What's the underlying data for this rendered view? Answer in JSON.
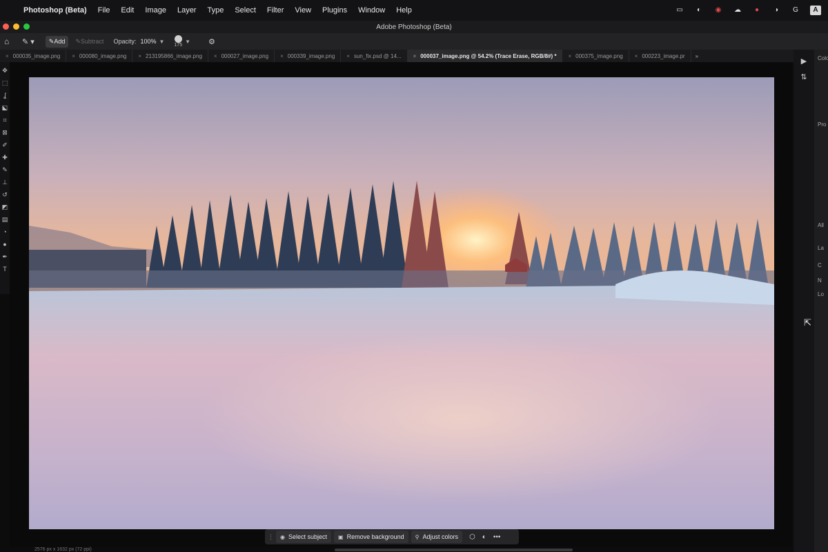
{
  "menubar": {
    "app_name": "Photoshop (Beta)",
    "items": [
      "File",
      "Edit",
      "Image",
      "Layer",
      "Type",
      "Select",
      "Filter",
      "View",
      "Plugins",
      "Window",
      "Help"
    ],
    "status_icons": [
      "display-icon",
      "sync-icon",
      "record-icon",
      "cloud-icon",
      "creative-cloud-icon",
      "toggle-icon",
      "grammarly-icon",
      "keyboard-a-icon"
    ],
    "keyboard_label": "A"
  },
  "window": {
    "title": "Adobe Photoshop (Beta)"
  },
  "options": {
    "add_label": "Add",
    "subtract_label": "Subtract",
    "opacity_label": "Opacity:",
    "opacity_value": "100%",
    "brush_size": "175"
  },
  "tabs": [
    {
      "label": "000035_image.png",
      "active": false
    },
    {
      "label": "000080_image.png",
      "active": false
    },
    {
      "label": "213195866_image.png",
      "active": false
    },
    {
      "label": "000027_image.png",
      "active": false
    },
    {
      "label": "000339_image.png",
      "active": false
    },
    {
      "label": "sun_fix.psd @ 14...",
      "active": false
    },
    {
      "label": "000037_image.png @ 54.2% (Trace Erase, RGB/8#) *",
      "active": true
    },
    {
      "label": "000375_image.png",
      "active": false
    },
    {
      "label": "000223_image.pr",
      "active": false
    }
  ],
  "tabs_more": "»",
  "right_panel_labels": [
    "Colo",
    "Pro",
    "All",
    "La",
    "C",
    "N",
    "Lo"
  ],
  "taskbar": {
    "select_subject": "Select subject",
    "remove_background": "Remove background",
    "adjust_colors": "Adjust colors",
    "more": "•••"
  },
  "statusbar": {
    "text": "2576 px x 1632 px (72 ppi)"
  },
  "colors": {
    "accent": "#ff5f57",
    "minimize": "#febc2e",
    "maximize": "#28c840"
  }
}
